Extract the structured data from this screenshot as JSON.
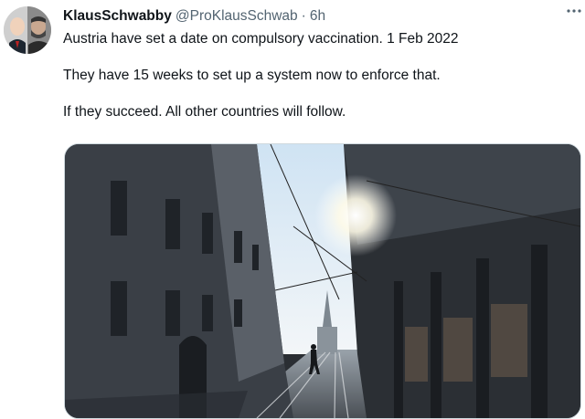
{
  "tweet": {
    "author_name": "KlausSchwabby",
    "author_handle": "@ProKlausSchwab",
    "separator": "·",
    "timestamp": "6h",
    "lines": [
      "Austria have set a date on compulsory vaccination. 1 Feb 2022",
      "They have 15 weeks to set up a system now to enforce that.",
      "If they succeed. All other countries will follow."
    ]
  },
  "icons": {
    "more": "more-horizontal-icon"
  },
  "colors": {
    "text": "#0f1419",
    "secondary": "#536471"
  }
}
